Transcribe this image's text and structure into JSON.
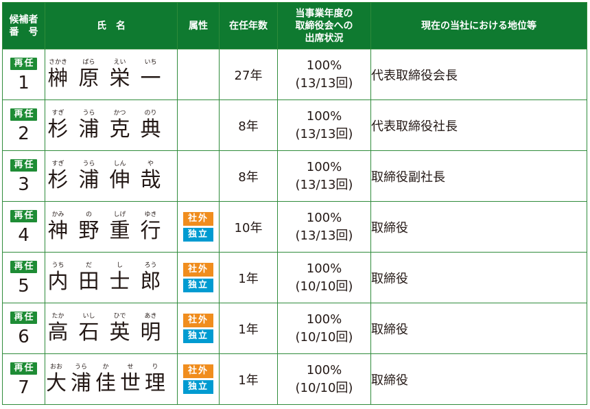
{
  "header": {
    "candidate_no": [
      "候補者",
      "番　号"
    ],
    "name": "氏　名",
    "attribute": "属性",
    "years": "在任年数",
    "attendance": [
      "当事業年度の",
      "取締役会への",
      "出席状況"
    ],
    "position": "現在の当社における地位等"
  },
  "labels": {
    "reappointed": "再任",
    "outside": "社外",
    "independent": "独立"
  },
  "rows": [
    {
      "no": "1",
      "chars": [
        [
          "さかき",
          "榊"
        ],
        [
          "ばら",
          "原"
        ],
        [
          "えい",
          "栄"
        ],
        [
          "いち",
          "一"
        ]
      ],
      "outside": false,
      "years": "27年",
      "att_pct": "100%",
      "att_count": "(13/13回)",
      "position": "代表取締役会長"
    },
    {
      "no": "2",
      "chars": [
        [
          "すぎ",
          "杉"
        ],
        [
          "うら",
          "浦"
        ],
        [
          "かつ",
          "克"
        ],
        [
          "のり",
          "典"
        ]
      ],
      "outside": false,
      "years": "8年",
      "att_pct": "100%",
      "att_count": "(13/13回)",
      "position": "代表取締役社長"
    },
    {
      "no": "3",
      "chars": [
        [
          "すぎ",
          "杉"
        ],
        [
          "うら",
          "浦"
        ],
        [
          "しん",
          "伸"
        ],
        [
          "や",
          "哉"
        ]
      ],
      "outside": false,
      "years": "8年",
      "att_pct": "100%",
      "att_count": "(13/13回)",
      "position": "取締役副社長"
    },
    {
      "no": "4",
      "chars": [
        [
          "かみ",
          "神"
        ],
        [
          "の",
          "野"
        ],
        [
          "しげ",
          "重"
        ],
        [
          "ゆき",
          "行"
        ]
      ],
      "outside": true,
      "years": "10年",
      "att_pct": "100%",
      "att_count": "(13/13回)",
      "position": "取締役"
    },
    {
      "no": "5",
      "chars": [
        [
          "うち",
          "内"
        ],
        [
          "だ",
          "田"
        ],
        [
          "し",
          "士"
        ],
        [
          "ろう",
          "郎"
        ]
      ],
      "outside": true,
      "years": "1年",
      "att_pct": "100%",
      "att_count": "(10/10回)",
      "position": "取締役"
    },
    {
      "no": "6",
      "chars": [
        [
          "たか",
          "高"
        ],
        [
          "いし",
          "石"
        ],
        [
          "ひで",
          "英"
        ],
        [
          "あき",
          "明"
        ]
      ],
      "outside": true,
      "years": "1年",
      "att_pct": "100%",
      "att_count": "(10/10回)",
      "position": "取締役"
    },
    {
      "no": "7",
      "chars": [
        [
          "おお",
          "大"
        ],
        [
          "うら",
          "浦"
        ],
        [
          "か",
          "佳"
        ],
        [
          "せ",
          "世"
        ],
        [
          "り",
          "理"
        ]
      ],
      "outside": true,
      "years": "1年",
      "att_pct": "100%",
      "att_count": "(10/10回)",
      "position": "取締役"
    }
  ]
}
